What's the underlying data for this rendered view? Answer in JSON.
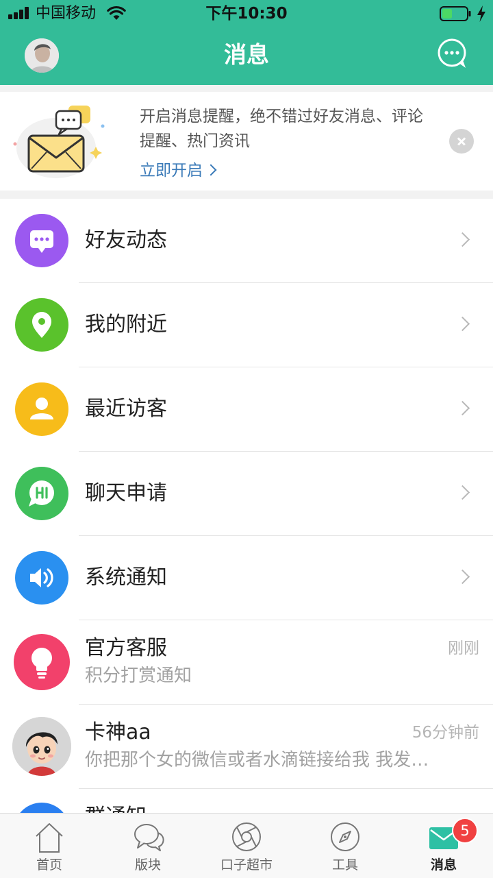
{
  "status_bar": {
    "carrier": "中国移动",
    "time": "下午10:30"
  },
  "header": {
    "title": "消息"
  },
  "banner": {
    "text": "开启消息提醒，绝不错过好友消息、评论提醒、热门资讯",
    "link_label": "立即开启"
  },
  "list": {
    "rows": [
      {
        "title": "好友动态",
        "icon": "chat-dots-icon",
        "color": "#9b59f0"
      },
      {
        "title": "我的附近",
        "icon": "location-pin-icon",
        "color": "#5ac22c"
      },
      {
        "title": "最近访客",
        "icon": "person-icon",
        "color": "#f7bc1a"
      },
      {
        "title": "聊天申请",
        "icon": "hi-bubble-icon",
        "color": "#3fbf5b"
      },
      {
        "title": "系统通知",
        "icon": "speaker-icon",
        "color": "#2a90f0"
      }
    ],
    "messages": [
      {
        "title": "官方客服",
        "subtitle": "积分打赏通知",
        "time": "刚刚",
        "icon": "lightbulb-icon",
        "color": "#f2416b"
      },
      {
        "title": "卡神aa",
        "subtitle": "你把那个女的微信或者水滴链接给我 我发…",
        "time": "56分钟前",
        "icon": "cartoon-avatar"
      },
      {
        "title": "群通知",
        "icon": "group-icon",
        "color": "#2a7ff0"
      }
    ]
  },
  "tabbar": {
    "tabs": [
      {
        "label": "首页",
        "icon": "home-icon"
      },
      {
        "label": "版块",
        "icon": "chat-bubbles-icon"
      },
      {
        "label": "口子超市",
        "icon": "aperture-icon"
      },
      {
        "label": "工具",
        "icon": "compass-icon"
      },
      {
        "label": "消息",
        "icon": "mail-icon",
        "active": true,
        "badge": "5"
      }
    ]
  },
  "colors": {
    "brand": "#33bc98",
    "badge": "#f04141",
    "link": "#3a7ab8"
  }
}
